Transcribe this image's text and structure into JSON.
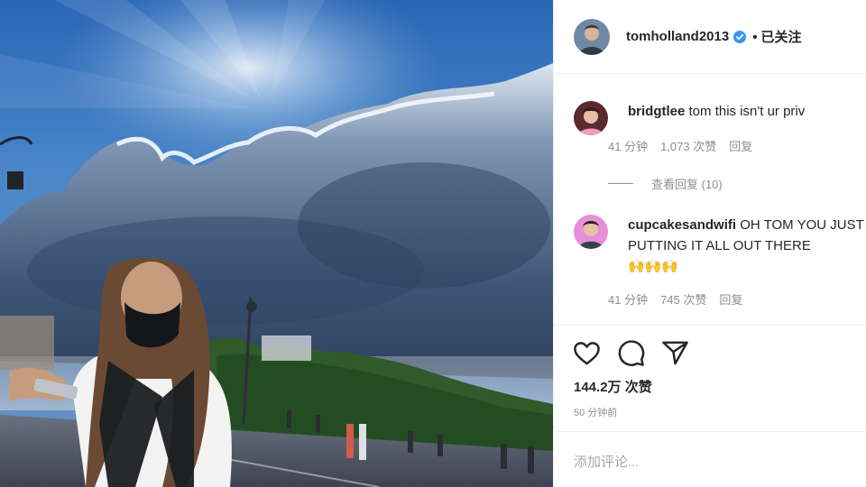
{
  "post": {
    "photo": {
      "alt": ""
    },
    "author": {
      "username": "tomholland2013",
      "verified_icon": "verified-badge-icon",
      "follow_dot": "•",
      "follow_label": "已关注"
    }
  },
  "comments": [
    {
      "username": "bridgtlee",
      "text": "tom this isn't ur priv",
      "time": "41 分钟",
      "likes": "1,073 次赞",
      "reply_label": "回复",
      "view_replies": "查看回复 (10)"
    },
    {
      "username": "cupcakesandwifi",
      "text": "OH TOM YOU JUST PUTTING IT ALL OUT THERE",
      "emoji": "🙌🙌🙌",
      "time": "41 分钟",
      "likes": "745 次赞",
      "reply_label": "回复"
    }
  ],
  "actions": {
    "like_icon": "heart-icon",
    "comment_icon": "comment-bubble-icon",
    "share_icon": "paper-plane-icon",
    "like_count": "144.2万 次赞",
    "time_ago": "50 分钟前"
  },
  "add_comment": {
    "placeholder": "添加评论..."
  },
  "colors": {
    "text": "#262626",
    "secondary": "#8e8e8e",
    "divider": "#efefef",
    "verified": "#3897f0"
  }
}
